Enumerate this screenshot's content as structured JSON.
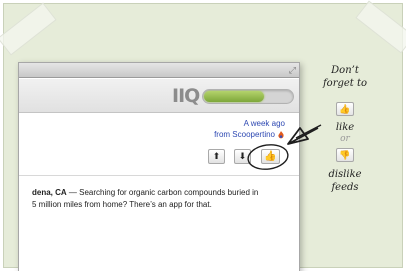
{
  "toolbar": {
    "logo": "IIQ",
    "progress_fraction": 0.68
  },
  "item": {
    "time": "A week ago",
    "source": "from Scoopertino"
  },
  "buttons": {
    "up": "⬆",
    "down": "⬇",
    "like": "👍"
  },
  "article": {
    "location": "dena, CA",
    "line1_rest": " — Searching for organic carbon compounds buried in",
    "line2": "5 million miles from home? There’s an app for that."
  },
  "callout": {
    "heading_1": "Don’t",
    "heading_2": "forget to",
    "like": "like",
    "or": "or",
    "dislike_1": "dislike",
    "dislike_2": "feeds",
    "like_icon": "👍",
    "dislike_icon": "👎"
  }
}
